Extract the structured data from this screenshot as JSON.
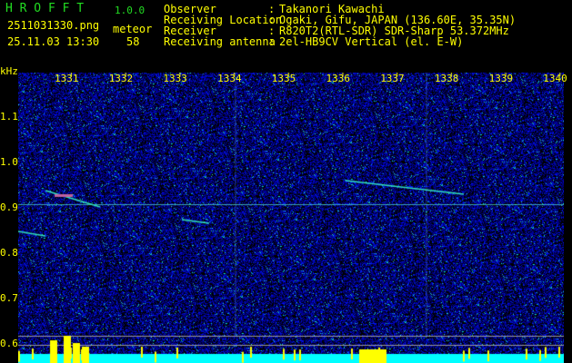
{
  "app": {
    "title": "H R O F F T",
    "version": "1.0.0"
  },
  "file": "2511031330.png",
  "datetime": "25.11.03 13:30",
  "meteor": {
    "label": "meteor",
    "count": "58"
  },
  "info": [
    {
      "key": "Observer",
      "value": "Takanori Kawachi"
    },
    {
      "key": "Receiving Location",
      "value": "Ogaki, Gifu, JAPAN (136.60E, 35.35N)"
    },
    {
      "key": "Receiver",
      "value": "R820T2(RTL-SDR) SDR-Sharp 53.372MHz"
    },
    {
      "key": "Receiving antenna",
      "value": "2el-HB9CV Vertical (el. E-W)"
    }
  ],
  "yunit": "kHz",
  "xticks": [
    "1331",
    "1332",
    "1333",
    "1334",
    "1335",
    "1336",
    "1337",
    "1338",
    "1339",
    "1340"
  ],
  "yticks": [
    "1.1",
    "1.0",
    "0.9",
    "0.8",
    "0.7",
    "0.6"
  ]
}
